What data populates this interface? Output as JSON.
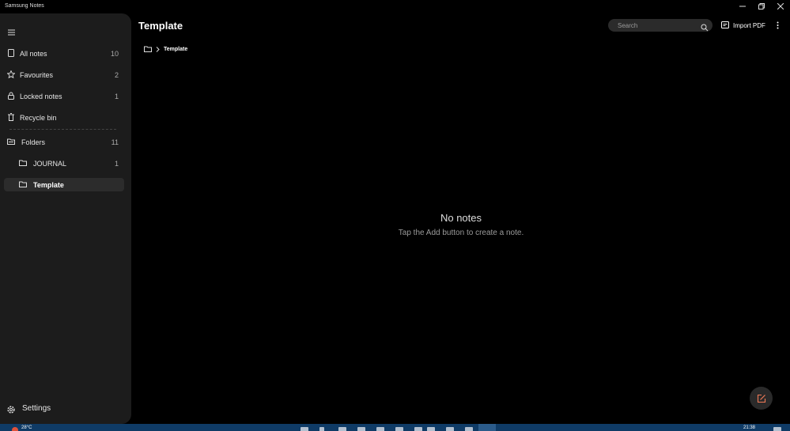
{
  "window": {
    "title": "Samsung Notes"
  },
  "sidebar": {
    "items": [
      {
        "label": "All notes",
        "count": "10",
        "icon": "note-icon"
      },
      {
        "label": "Favourites",
        "count": "2",
        "icon": "star-icon"
      },
      {
        "label": "Locked notes",
        "count": "1",
        "icon": "lock-icon"
      },
      {
        "label": "Recycle bin",
        "count": "",
        "icon": "trash-icon"
      }
    ],
    "folders": {
      "label": "Folders",
      "count": "11",
      "icon": "folders-icon"
    },
    "subfolders": [
      {
        "label": "JOURNAL",
        "count": "1",
        "icon": "folder-icon"
      },
      {
        "label": "Template",
        "count": "",
        "icon": "folder-icon",
        "selected": true
      }
    ],
    "settings": {
      "label": "Settings",
      "icon": "gear-icon"
    }
  },
  "main": {
    "title": "Template",
    "search_placeholder": "Search",
    "import_label": "Import PDF",
    "breadcrumb": {
      "label": "Template"
    },
    "empty_title": "No notes",
    "empty_subtitle": "Tap the Add button to create a note."
  },
  "taskbar": {
    "temp": "28°C",
    "clock": "21:38"
  }
}
